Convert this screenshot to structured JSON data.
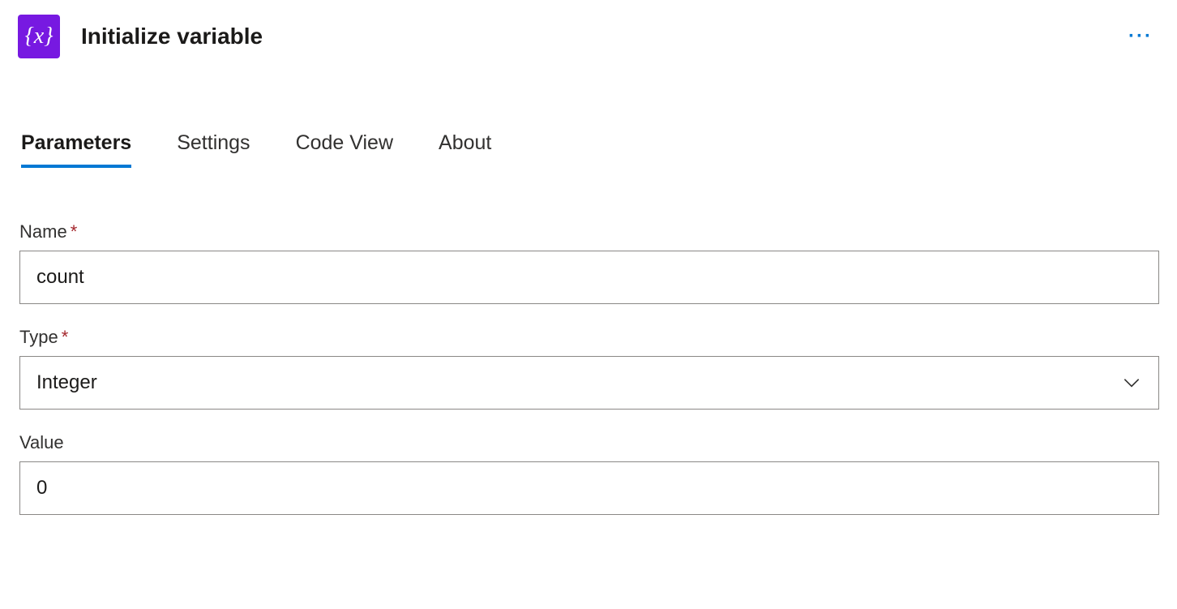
{
  "header": {
    "title": "Initialize variable",
    "icon_glyph": "{x}"
  },
  "tabs": [
    {
      "label": "Parameters",
      "active": true
    },
    {
      "label": "Settings",
      "active": false
    },
    {
      "label": "Code View",
      "active": false
    },
    {
      "label": "About",
      "active": false
    }
  ],
  "fields": {
    "name": {
      "label": "Name",
      "required": true,
      "value": "count"
    },
    "type": {
      "label": "Type",
      "required": true,
      "value": "Integer"
    },
    "value": {
      "label": "Value",
      "required": false,
      "value": "0"
    }
  },
  "required_marker": "*"
}
